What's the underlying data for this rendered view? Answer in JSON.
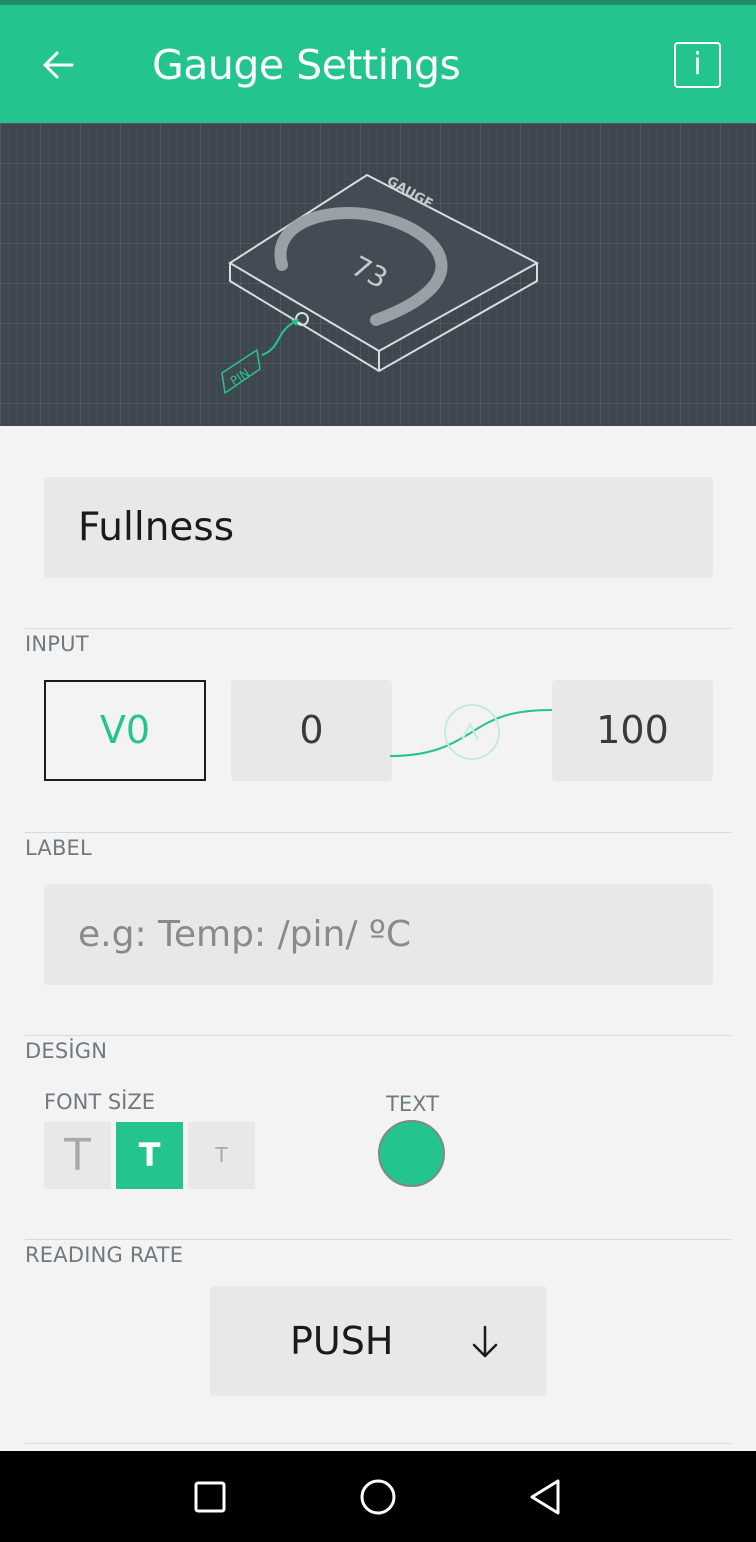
{
  "header": {
    "title": "Gauge Settings",
    "info_label": "i"
  },
  "hero": {
    "widget_name": "GAUGE",
    "gauge_value": "73",
    "pin_label": "PIN"
  },
  "name_field": {
    "value": "Fullness"
  },
  "input": {
    "section_label": "INPUT",
    "pin": "V0",
    "min": "0",
    "max": "100"
  },
  "label": {
    "section_label": "LABEL",
    "placeholder": "e.g: Temp: /pin/ ºC",
    "value": ""
  },
  "design": {
    "section_label": "DESİGN",
    "font_size_label": "FONT SİZE",
    "font_sizes": [
      "T",
      "T",
      "T"
    ],
    "selected_font_size_index": 1,
    "text_color_label": "TEXT",
    "text_color": "#23c48e"
  },
  "reading_rate": {
    "section_label": "READING RATE",
    "value": "PUSH"
  },
  "colors": {
    "accent": "#23c48e",
    "hero_bg": "#3e4750",
    "background": "#f3f3f3"
  }
}
